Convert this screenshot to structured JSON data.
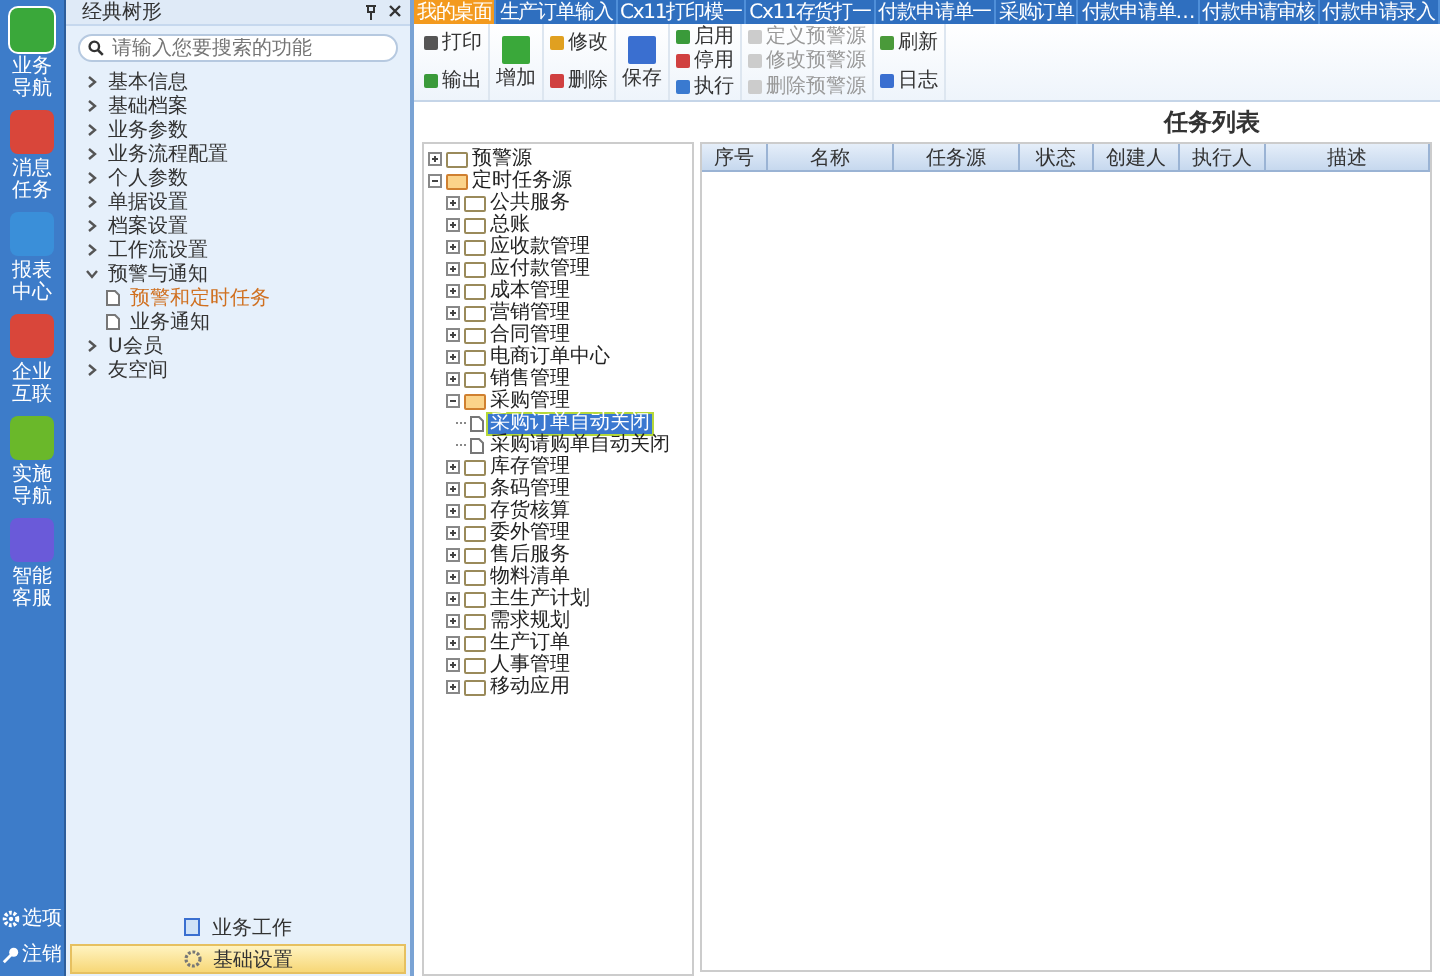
{
  "rail": {
    "items": [
      {
        "label": "业务导航",
        "kind": "nav",
        "selected": true
      },
      {
        "label": "消息任务",
        "kind": "msg",
        "selected": false
      },
      {
        "label": "报表中心",
        "kind": "report",
        "selected": false
      },
      {
        "label": "企业互联",
        "kind": "link",
        "selected": false
      },
      {
        "label": "实施导航",
        "kind": "impl",
        "selected": false
      },
      {
        "label": "智能客服",
        "kind": "service",
        "selected": false
      }
    ],
    "bottom": [
      {
        "label": "选项",
        "kind": "gear"
      },
      {
        "label": "注销",
        "kind": "key"
      }
    ]
  },
  "panel": {
    "title": "经典树形",
    "search": {
      "placeholder": "请输入您要搜索的功能"
    },
    "items": [
      {
        "label": "基本信息",
        "expanded": false
      },
      {
        "label": "基础档案",
        "expanded": false
      },
      {
        "label": "业务参数",
        "expanded": false
      },
      {
        "label": "业务流程配置",
        "expanded": false
      },
      {
        "label": "个人参数",
        "expanded": false
      },
      {
        "label": "单据设置",
        "expanded": false
      },
      {
        "label": "档案设置",
        "expanded": false
      },
      {
        "label": "工作流设置",
        "expanded": false
      },
      {
        "label": "预警与通知",
        "expanded": true,
        "children": [
          {
            "label": "预警和定时任务",
            "selected": true
          },
          {
            "label": "业务通知",
            "selected": false
          }
        ]
      },
      {
        "label": "U会员",
        "expanded": false
      },
      {
        "label": "友空间",
        "expanded": false
      }
    ],
    "sections": [
      {
        "label": "业务工作",
        "selected": false
      },
      {
        "label": "基础设置",
        "selected": true
      }
    ]
  },
  "tabs": [
    {
      "label": "我的桌面",
      "selected": true
    },
    {
      "label": "生产订单输入",
      "selected": false
    },
    {
      "label": "Cx11打印模一",
      "selected": false
    },
    {
      "label": "Cx11存货打一",
      "selected": false
    },
    {
      "label": "付款申请单一",
      "selected": false
    },
    {
      "label": "采购订单",
      "selected": false
    },
    {
      "label": "付款申请单…",
      "selected": false
    },
    {
      "label": "付款申请审核",
      "selected": false
    },
    {
      "label": "付款申请录入",
      "selected": false
    }
  ],
  "toolbar": {
    "groups": [
      [
        {
          "label": "打印",
          "kind": "small",
          "disabled": false
        },
        {
          "label": "输出",
          "kind": "small",
          "disabled": false
        }
      ],
      [
        {
          "label": "增加",
          "kind": "large",
          "disabled": false
        }
      ],
      [
        {
          "label": "修改",
          "kind": "small",
          "disabled": false
        },
        {
          "label": "删除",
          "kind": "small",
          "disabled": false
        }
      ],
      [
        {
          "label": "保存",
          "kind": "large",
          "disabled": false
        }
      ],
      [
        {
          "label": "启用",
          "kind": "small",
          "disabled": false
        },
        {
          "label": "停用",
          "kind": "small",
          "disabled": false
        },
        {
          "label": "执行",
          "kind": "small",
          "disabled": false
        }
      ],
      [
        {
          "label": "定义预警源",
          "kind": "small",
          "disabled": true
        },
        {
          "label": "修改预警源",
          "kind": "small",
          "disabled": true
        },
        {
          "label": "删除预警源",
          "kind": "small",
          "disabled": true
        }
      ],
      [
        {
          "label": "刷新",
          "kind": "small",
          "disabled": false
        },
        {
          "label": "日志",
          "kind": "small",
          "disabled": false
        }
      ]
    ]
  },
  "title": "任务列表",
  "tree": [
    {
      "label": "预警源",
      "expanded": false
    },
    {
      "label": "定时任务源",
      "expanded": true,
      "children": [
        {
          "label": "公共服务",
          "expanded": false
        },
        {
          "label": "总账",
          "expanded": false
        },
        {
          "label": "应收款管理",
          "expanded": false
        },
        {
          "label": "应付款管理",
          "expanded": false
        },
        {
          "label": "成本管理",
          "expanded": false
        },
        {
          "label": "营销管理",
          "expanded": false
        },
        {
          "label": "合同管理",
          "expanded": false
        },
        {
          "label": "电商订单中心",
          "expanded": false
        },
        {
          "label": "销售管理",
          "expanded": false
        },
        {
          "label": "采购管理",
          "expanded": true,
          "children": [
            {
              "label": "采购订单自动关闭",
              "selected": true
            },
            {
              "label": "采购请购单自动关闭",
              "selected": false
            }
          ]
        },
        {
          "label": "库存管理",
          "expanded": false
        },
        {
          "label": "条码管理",
          "expanded": false
        },
        {
          "label": "存货核算",
          "expanded": false
        },
        {
          "label": "委外管理",
          "expanded": false
        },
        {
          "label": "售后服务",
          "expanded": false
        },
        {
          "label": "物料清单",
          "expanded": false
        },
        {
          "label": "主生产计划",
          "expanded": false
        },
        {
          "label": "需求规划",
          "expanded": false
        },
        {
          "label": "生产订单",
          "expanded": false
        },
        {
          "label": "人事管理",
          "expanded": false
        },
        {
          "label": "移动应用",
          "expanded": false
        }
      ]
    }
  ],
  "table": {
    "columns": [
      "序号",
      "名称",
      "任务源",
      "状态",
      "创建人",
      "执行人",
      "描述"
    ]
  }
}
